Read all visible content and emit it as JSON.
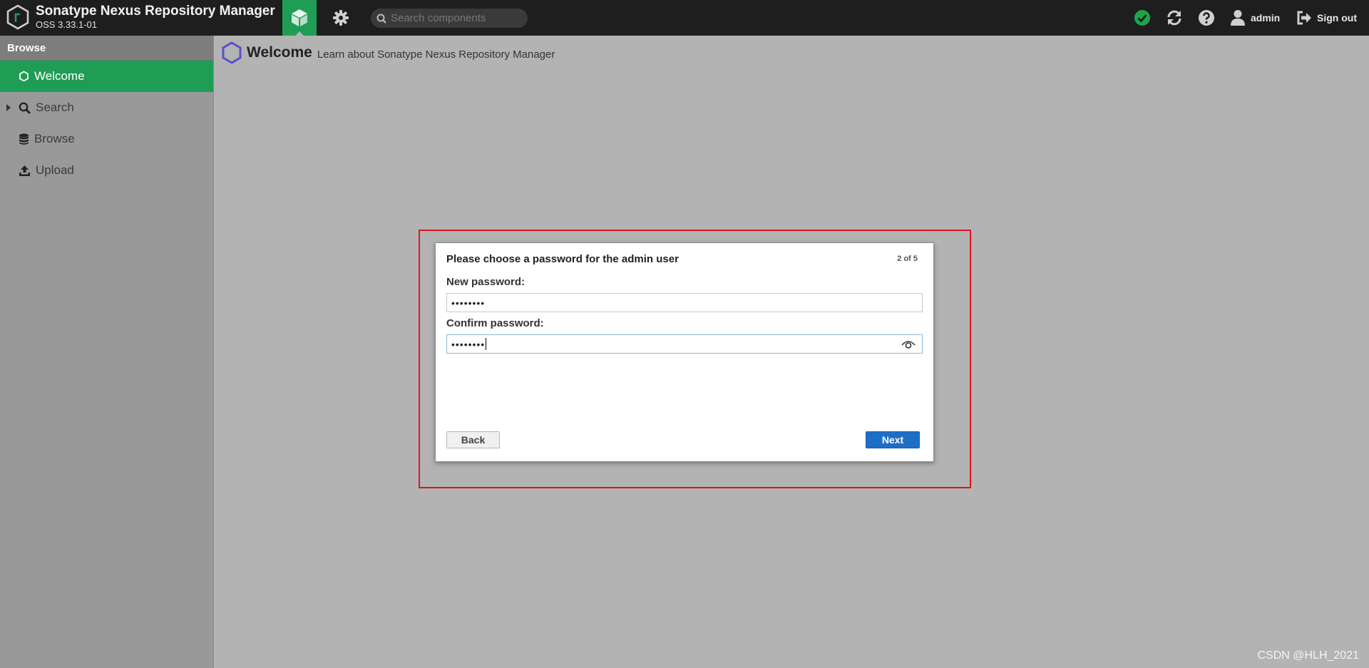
{
  "app": {
    "title": "Sonatype Nexus Repository Manager",
    "version": "OSS 3.33.1-01"
  },
  "toolbar": {
    "search_placeholder": "Search components",
    "user_label": "admin",
    "signout_label": "Sign out"
  },
  "icons": {
    "logo": "nexus-hexagon-icon",
    "browse_mode": "cube-icon",
    "admin_mode": "gear-icon",
    "search": "search-icon",
    "status": "check-circle-icon",
    "refresh": "refresh-icon",
    "help": "help-icon",
    "user": "user-icon",
    "signout": "signout-icon"
  },
  "sidebar": {
    "header": "Browse",
    "items": [
      {
        "label": "Welcome",
        "icon": "hexagon-icon",
        "active": true
      },
      {
        "label": "Search",
        "icon": "search-icon",
        "active": false
      },
      {
        "label": "Browse",
        "icon": "database-icon",
        "active": false
      },
      {
        "label": "Upload",
        "icon": "upload-icon",
        "active": false
      }
    ]
  },
  "content": {
    "title": "Welcome",
    "subtitle": "Learn about Sonatype Nexus Repository Manager"
  },
  "dialog": {
    "title": "Please choose a password for the admin user",
    "step": "2 of 5",
    "new_password_label": "New password:",
    "new_password_value": "••••••••",
    "confirm_password_label": "Confirm password:",
    "confirm_password_value": "••••••••",
    "back_label": "Back",
    "next_label": "Next"
  },
  "watermark": "CSDN @HLH_2021",
  "colors": {
    "topbar": "#1e1e1e",
    "accent_green": "#1f9d55",
    "sidebar": "#999999",
    "content_bg": "#b3b3b3",
    "next_button": "#1f6ec5",
    "highlight_border": "#e0141e",
    "status_green": "#1fa34a"
  }
}
